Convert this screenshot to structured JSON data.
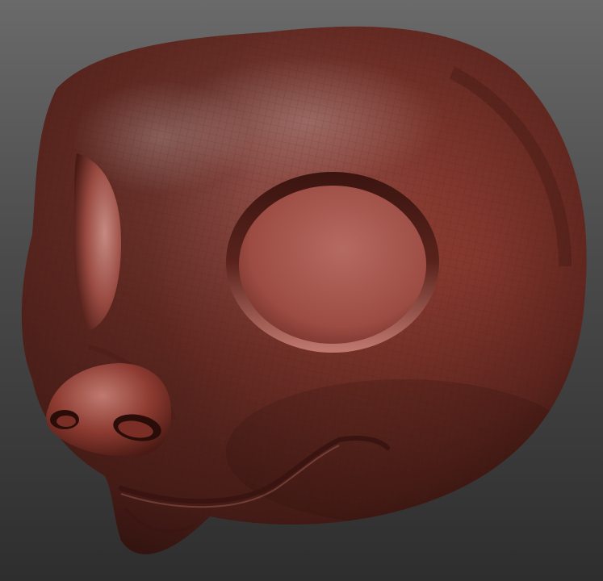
{
  "scene": {
    "subject": "head-sculpt",
    "material_color": "#8a3a2e",
    "highlight_color": "#c07a70",
    "shadow_color": "#3a1410",
    "background_top": "#6a6a6a",
    "background_bottom": "#2e2e2e"
  }
}
